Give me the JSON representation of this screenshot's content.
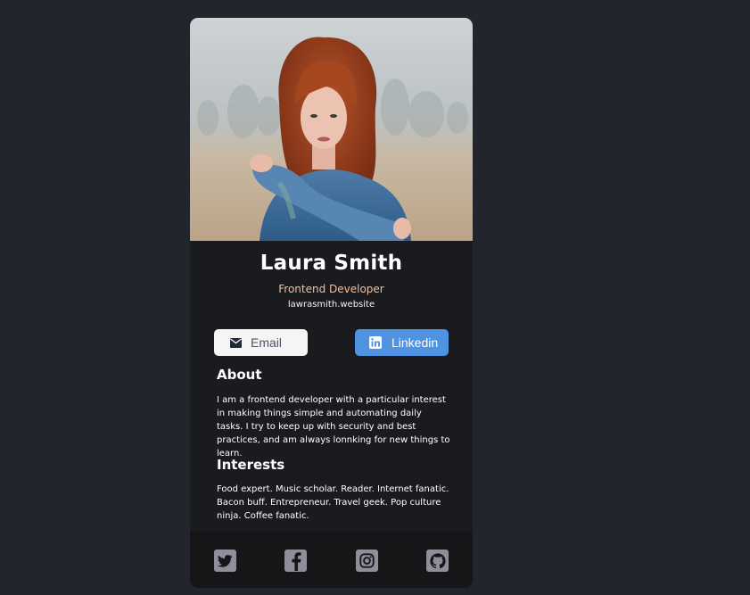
{
  "profile": {
    "name": "Laura Smith",
    "role": "Frontend Developer",
    "website": "lawrasmith.website",
    "photo_icon": "profile-photo"
  },
  "buttons": {
    "email": {
      "label": "Email",
      "icon": "envelope-icon"
    },
    "linkedin": {
      "label": "Linkedin",
      "icon": "linkedin-icon"
    }
  },
  "about": {
    "title": "About",
    "text": "I am a frontend developer with a particular interest in making things simple and automating daily tasks. I try to keep up with security and best practices, and am always lonnking for new things to learn."
  },
  "interests": {
    "title": "Interests",
    "text": "Food expert. Music scholar. Reader. Internet fanatic. Bacon buff. Entrepreneur. Travel geek. Pop culture ninja. Coffee fanatic."
  },
  "footer": {
    "icons": [
      "twitter-icon",
      "facebook-icon",
      "instagram-icon",
      "github-icon"
    ]
  },
  "colors": {
    "page_background": "#23252c",
    "card_background": "#1a1b1f",
    "footer_background": "#161619",
    "role_accent": "#f3bf99",
    "linkedin_blue": "#5093e2",
    "social_icon": "#918e9b"
  }
}
